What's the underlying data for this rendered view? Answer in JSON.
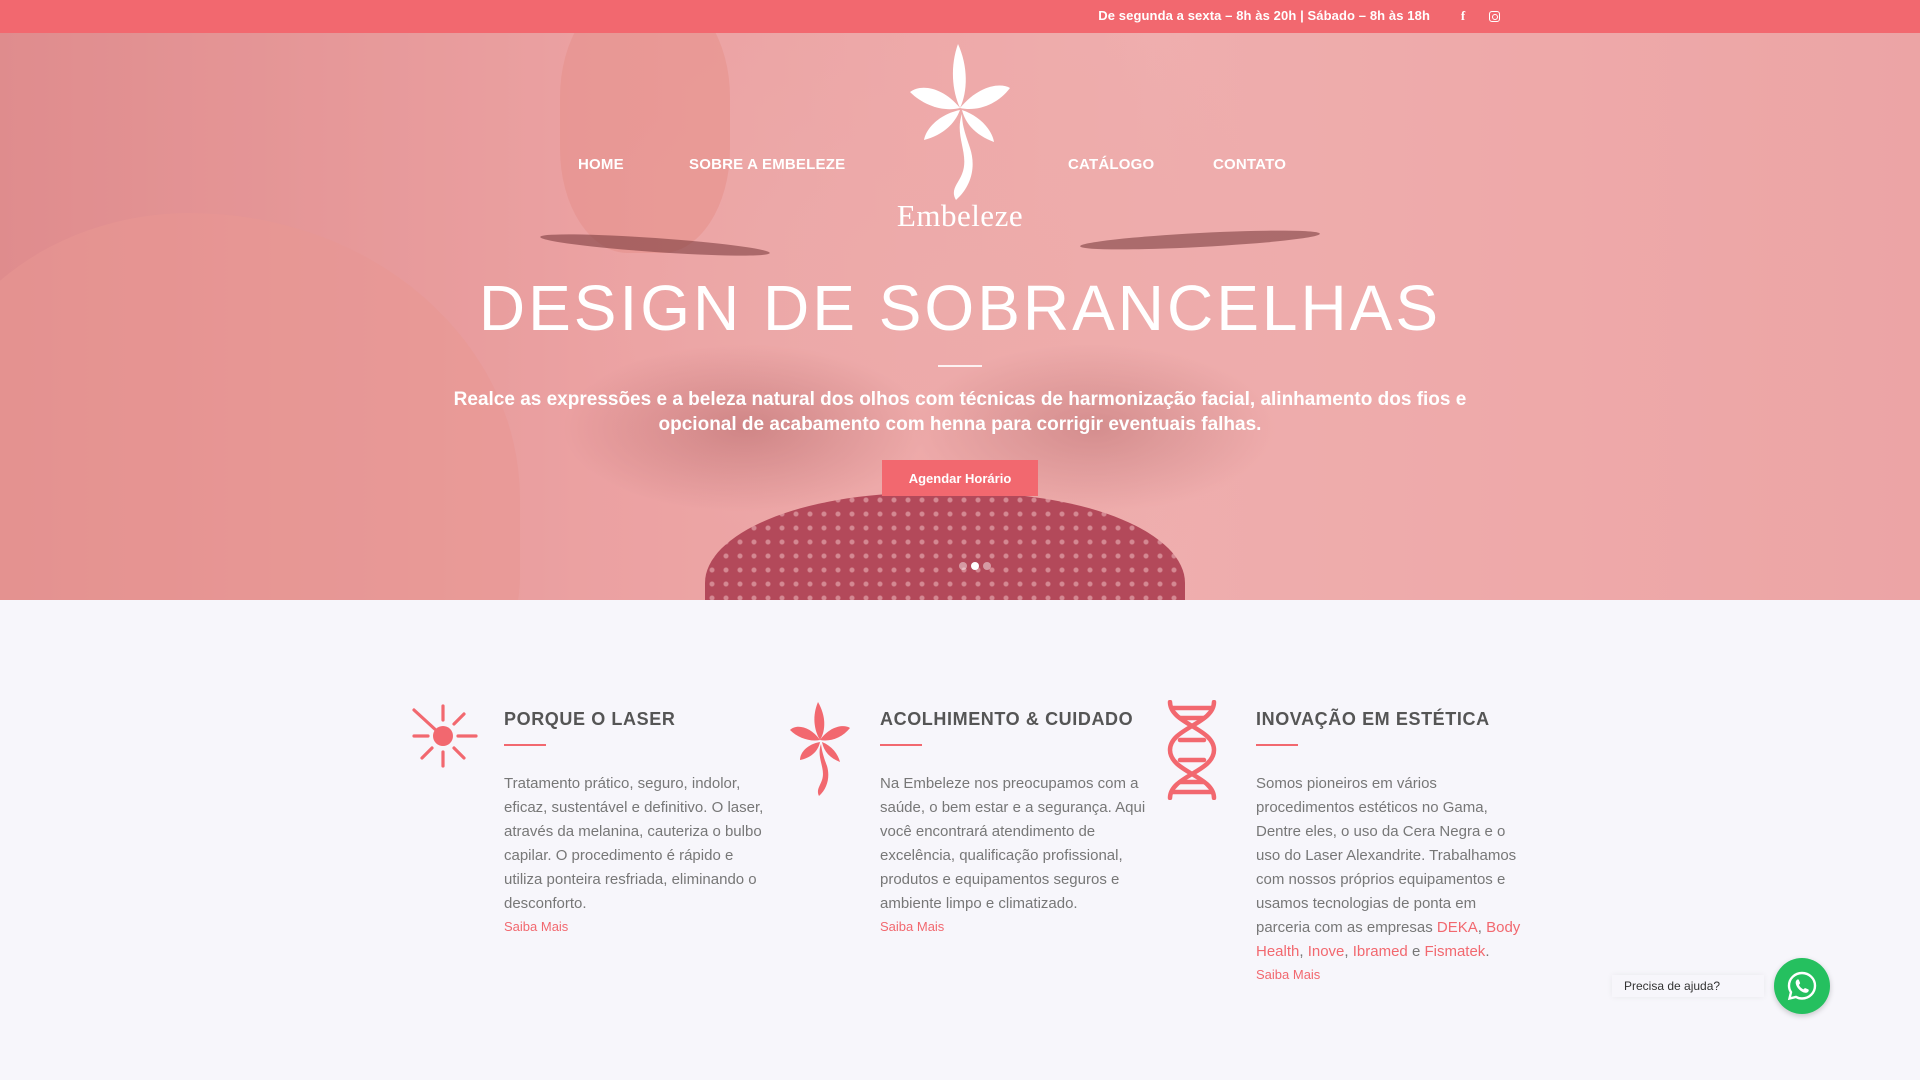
{
  "topbar": {
    "hours": "De segunda a sexta – 8h às 20h | Sábado – 8h às 18h",
    "facebook_icon": "f",
    "instagram_icon": "instagram-icon"
  },
  "nav": {
    "home": "HOME",
    "sobre": "SOBRE A EMBELEZE",
    "catalogo": "CATÁLOGO",
    "contato": "CONTATO"
  },
  "logo": {
    "text": "Embeleze"
  },
  "hero": {
    "title": "DESIGN DE SOBRANCELHAS",
    "subtitle": "Realce as expressões e a beleza natural dos olhos com técnicas de harmonização facial, alinhamento dos fios e opcional de acabamento com henna para corrigir eventuais falhas.",
    "button": "Agendar Horário",
    "slides": 3,
    "active_slide": 2
  },
  "features": [
    {
      "icon": "laser-icon",
      "title": "PORQUE O LASER",
      "text": "Tratamento prático, seguro, indolor, eficaz, sustentável e definitivo. O laser, através da melanina, cauteriza o bulbo capilar. O procedimento é rápido e utiliza ponteira resfriada, eliminando o desconforto.",
      "more": "Saiba Mais"
    },
    {
      "icon": "flower-icon",
      "title": "ACOLHIMENTO & CUIDADO",
      "text": "Na Embeleze nos preocupamos com a saúde, o bem estar e a segurança. Aqui você encontrará atendimento de excelência, qualificação profissional, produtos e equipamentos seguros e ambiente limpo e climatizado.",
      "more": "Saiba Mais"
    },
    {
      "icon": "dna-icon",
      "title": "INOVAÇÃO EM ESTÉTICA",
      "text_before": "Somos pioneiros em vários procedimentos estéticos no Gama, Dentre eles, o uso da Cera Negra e o uso do Laser  Alexandrite. Trabalhamos com nossos próprios equipamentos e usamos tecnologias de ponta em parceria com as empresas ",
      "brands": [
        "DEKA",
        "Body Health",
        "Inove",
        "Ibramed",
        "Fismatek"
      ],
      "sep1": ", ",
      "sep2": ", ",
      "sep3": ", ",
      "sep4": " e ",
      "end": ".",
      "more": "Saiba Mais"
    }
  ],
  "whatsapp": {
    "label": "Precisa de ajuda?",
    "icon": "whatsapp-icon"
  },
  "colors": {
    "accent": "#f2686f",
    "background": "#f7f6fb",
    "whatsapp": "#25c05f"
  }
}
